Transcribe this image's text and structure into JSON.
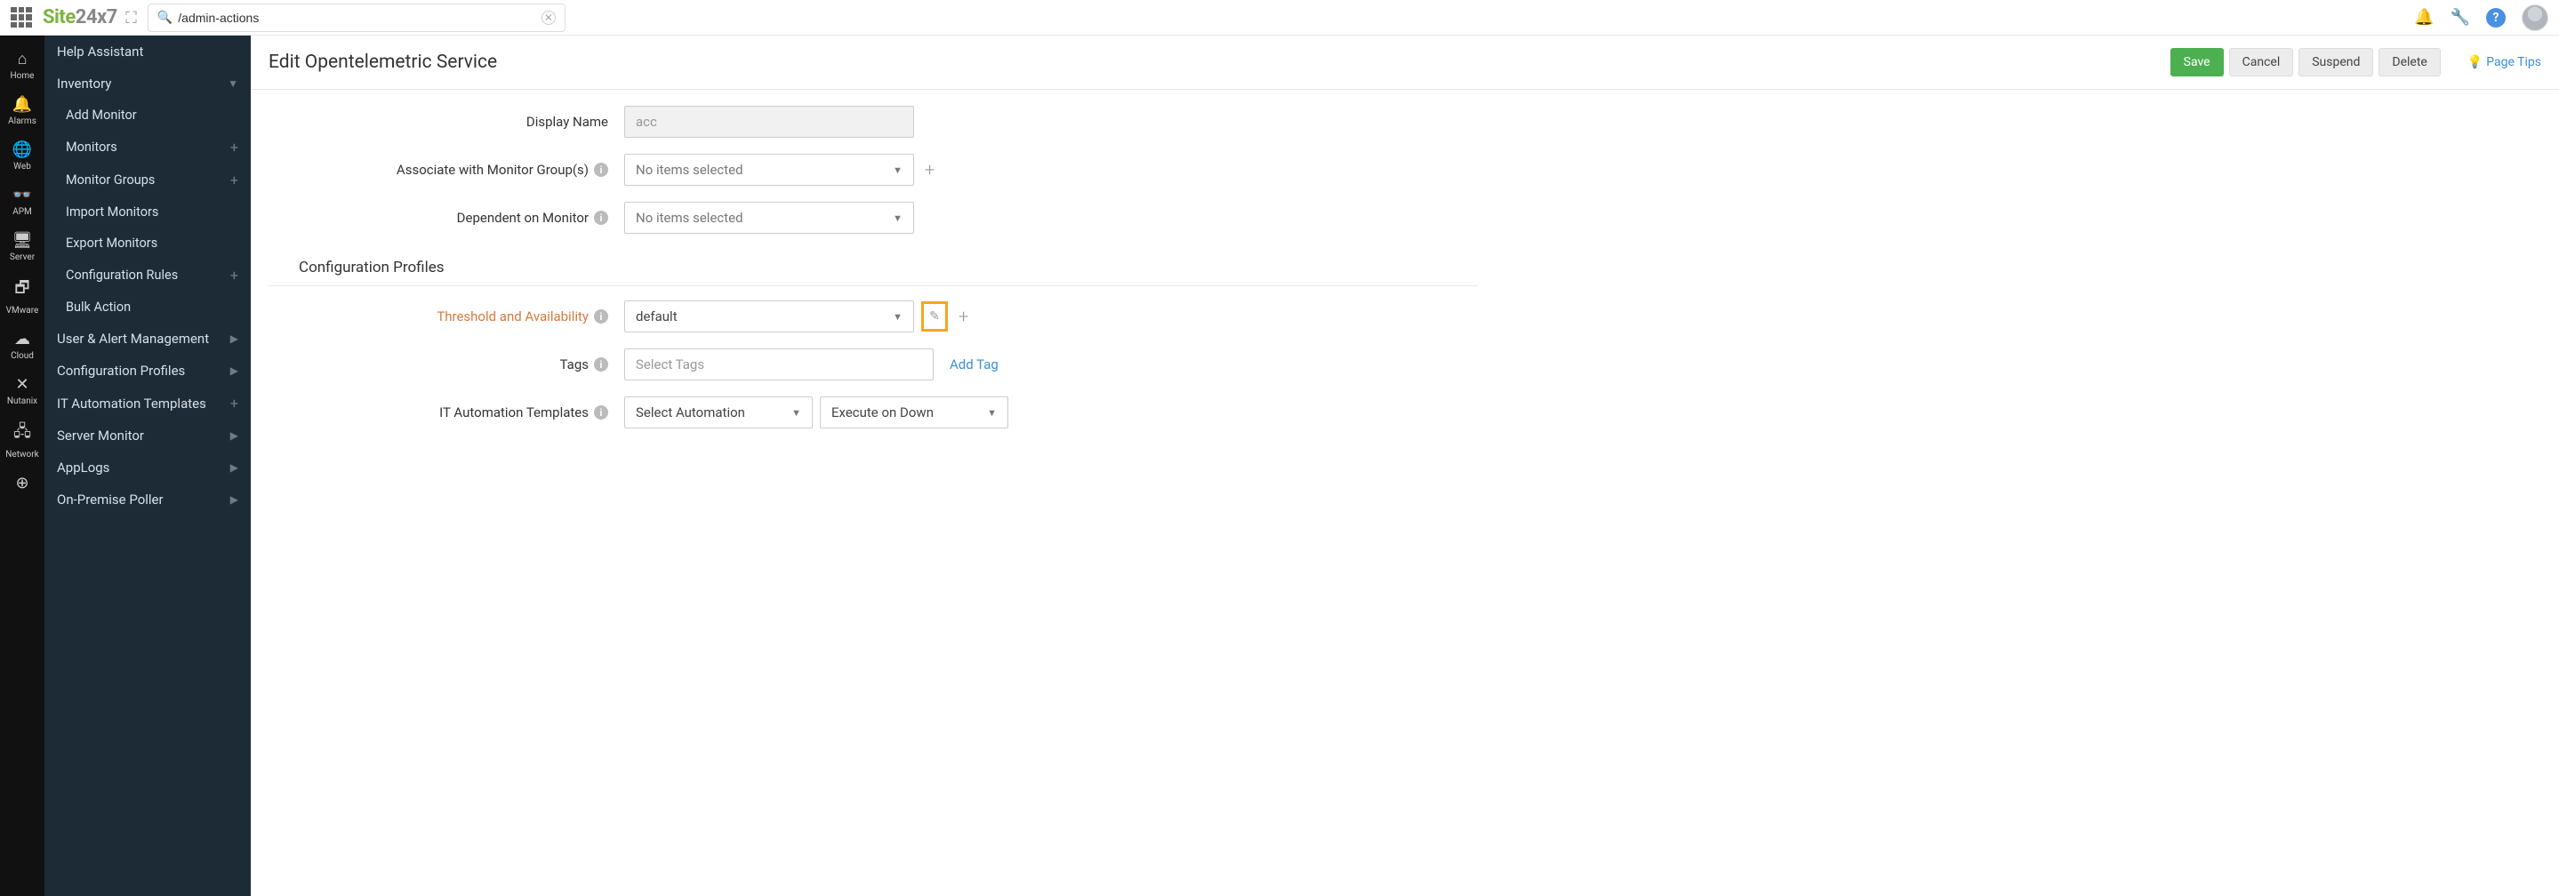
{
  "brand": {
    "part1": "Site",
    "part2": "24x7"
  },
  "search": {
    "value": "/admin-actions"
  },
  "rail": [
    {
      "icon": "home-icon",
      "glyph": "⌂",
      "label": "Home"
    },
    {
      "icon": "bell-icon",
      "glyph": "🔔",
      "label": "Alarms"
    },
    {
      "icon": "globe-icon",
      "glyph": "🌐",
      "label": "Web"
    },
    {
      "icon": "apm-icon",
      "glyph": "👓",
      "label": "APM"
    },
    {
      "icon": "server-icon",
      "glyph": "🖥",
      "label": "Server"
    },
    {
      "icon": "vmware-icon",
      "glyph": "🗗",
      "label": "VMware"
    },
    {
      "icon": "cloud-icon",
      "glyph": "☁",
      "label": "Cloud"
    },
    {
      "icon": "nutanix-icon",
      "glyph": "✕",
      "label": "Nutanix"
    },
    {
      "icon": "network-icon",
      "glyph": "🖧",
      "label": "Network"
    },
    {
      "icon": "more-icon",
      "glyph": "⊕",
      "label": ""
    }
  ],
  "sidebar": {
    "help_assistant": "Help Assistant",
    "inventory": "Inventory",
    "inv_items": {
      "add_monitor": "Add Monitor",
      "monitors": "Monitors",
      "monitor_groups": "Monitor Groups",
      "import_monitors": "Import Monitors",
      "export_monitors": "Export Monitors",
      "configuration_rules": "Configuration Rules",
      "bulk_action": "Bulk Action"
    },
    "user_alert": "User & Alert Management",
    "config_profiles": "Configuration Profiles",
    "it_automation": "IT Automation Templates",
    "server_monitor": "Server Monitor",
    "applogs": "AppLogs",
    "on_premise": "On-Premise Poller"
  },
  "page": {
    "title": "Edit Opentelemetric Service",
    "save": "Save",
    "cancel": "Cancel",
    "suspend": "Suspend",
    "delete": "Delete",
    "page_tips": "Page Tips"
  },
  "form": {
    "display_name_label": "Display Name",
    "display_name_value": "acc",
    "assoc_groups_label": "Associate with Monitor Group(s)",
    "assoc_groups_value": "No items selected",
    "dependent_label": "Dependent on Monitor",
    "dependent_value": "No items selected",
    "section_config_profiles": "Configuration Profiles",
    "threshold_label": "Threshold and Availability",
    "threshold_value": "default",
    "tags_label": "Tags",
    "tags_placeholder": "Select Tags",
    "add_tag": "Add Tag",
    "it_auto_label": "IT Automation Templates",
    "it_auto_select": "Select Automation",
    "it_auto_exec": "Execute on Down"
  }
}
